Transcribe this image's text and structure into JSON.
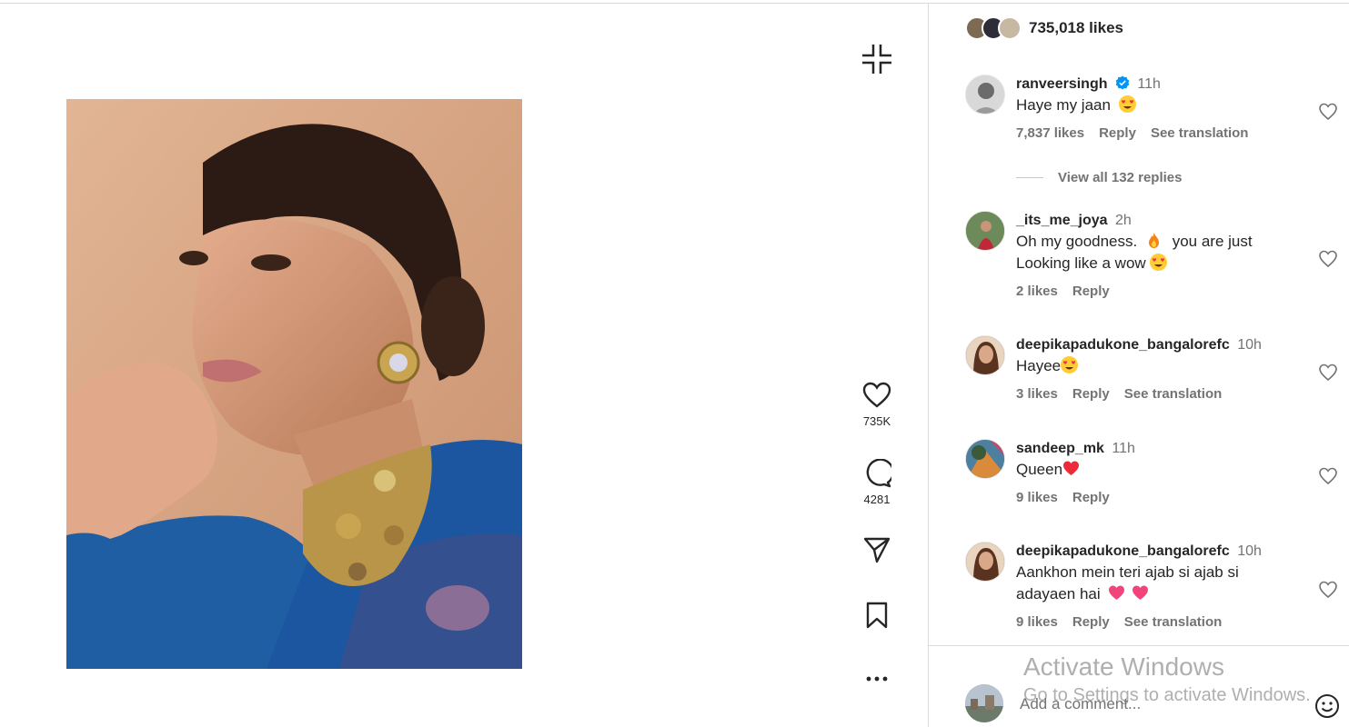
{
  "post": {
    "likes_summary": "735,018 likes",
    "like_count_short": "735K",
    "comment_count": "4281"
  },
  "comments": [
    {
      "username": "ranveersingh",
      "verified": true,
      "time": "11h",
      "text": "Haye my jaan",
      "emoji": [
        "heart-eyes"
      ],
      "likes": "7,837 likes",
      "reply": "Reply",
      "see_translation": "See translation",
      "view_replies": "View all 132 replies"
    },
    {
      "username": "_its_me_joya",
      "time": "2h",
      "text_line1": "Oh my goodness.",
      "text_line1b": "you are just",
      "text_line2": "Looking like a wow",
      "likes": "2 likes",
      "reply": "Reply"
    },
    {
      "username": "deepikapadukone_bangalorefc",
      "time": "10h",
      "text": "Hayee",
      "likes": "3 likes",
      "reply": "Reply",
      "see_translation": "See translation"
    },
    {
      "username": "sandeep_mk",
      "time": "11h",
      "text": "Queen",
      "likes": "9 likes",
      "reply": "Reply"
    },
    {
      "username": "deepikapadukone_bangalorefc",
      "time": "10h",
      "text_line1": "Aankhon mein teri ajab si ajab si",
      "text_line2": "adayaen hai",
      "likes": "9 likes",
      "reply": "Reply",
      "see_translation": "See translation"
    }
  ],
  "composer": {
    "placeholder": "Add a comment..."
  },
  "watermark": {
    "title": "Activate Windows",
    "subtitle": "Go to Settings to activate Windows."
  },
  "icons": {
    "collapse": "collapse-icon",
    "like": "heart-icon",
    "comment": "comment-icon",
    "share": "share-icon",
    "save": "bookmark-icon",
    "more": "more-icon",
    "verified": "verified-badge-icon",
    "emoji": "emoji-icon"
  },
  "colors": {
    "verified_blue": "#0095f6",
    "muted_text": "#737373",
    "emoji_yellow": "#ffcc33",
    "heart_red": "#ed2a3a",
    "pink_heart": "#f0457a"
  }
}
